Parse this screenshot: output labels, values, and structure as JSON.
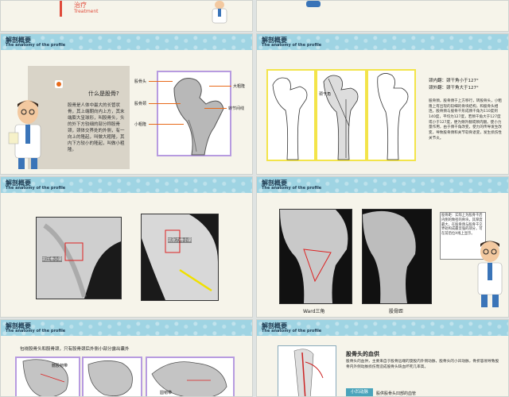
{
  "slide0": {
    "title_cn": "治疗",
    "title_en": "Treatment"
  },
  "header": {
    "title_cn": "解剖概要",
    "title_en": "The anatomy of the profile"
  },
  "slide1": {
    "question": "什么是股骨?",
    "body": "股骨是人体中最大的长管状骨，其上端朝向内上方，其末端膨大呈球形，叫股骨头，头的外下方较细的部分称股骨颈，颈体交界处的外侧，有一向上的隆起，叫做大粗隆，其内下方较小的隆起，叫做小粗隆。",
    "labels": [
      "股骨头",
      "股骨颈",
      "小粗隆",
      "大粗隆",
      "转节间线"
    ]
  },
  "slide2": {
    "angle1": "颈内翻：颈干角小于127°",
    "angle2": "颈外翻：颈干角大于127°",
    "label_neck_angle": "颈干角",
    "body": "股骨颈，股骨颈于上方移行，转股骨头，小粗隆上有出现的较细的骨块结构，和股骨头相连。股骨颈与股骨干形成颈干角为110度到140度，平均为127度，若颈干角大于127度或小于127度，便为颈外翻或颈内翻。使小力量作用，由于颈干角改变，使力的传导发生改变，导致股骨颈和关节软骨退变，发生损伤性关节炎。"
  },
  "slide3": {
    "label_a": "抗压骨小梁",
    "label_b": "抗张力骨小梁"
  },
  "slide4": {
    "label_ward": "Ward三角",
    "label_calcar": "股骨距",
    "note": "股骨距：实际上为股骨干后内侧的致密的骨块，其厚度最大，在股骨颈与股骨干交界处构成最坚强的部分，可在前后位X线上显示。"
  },
  "slide5": {
    "caption": "包绕股骨头和股骨颈，只有股骨颈后外侧小部分露出囊外",
    "labels": [
      "髂股韧带",
      "圆韧带"
    ]
  },
  "slide6": {
    "heading": "股骨头的血供",
    "body": "股骨头的血供，主要来自于股骨远端的旋股内外侧动脉，股骨头的小凹动脉，骨折容易导致股骨内外侧动脉损伤而造成股骨头缺血坏死几率高。",
    "tag": "小凹动脉",
    "tag_desc": "股供股骨头凹部的血管"
  },
  "colors": {
    "header": "#9fd4e3",
    "frame_purple": "#b79be0",
    "frame_yellow": "#f3e44a",
    "accent": "#e86a1a"
  }
}
